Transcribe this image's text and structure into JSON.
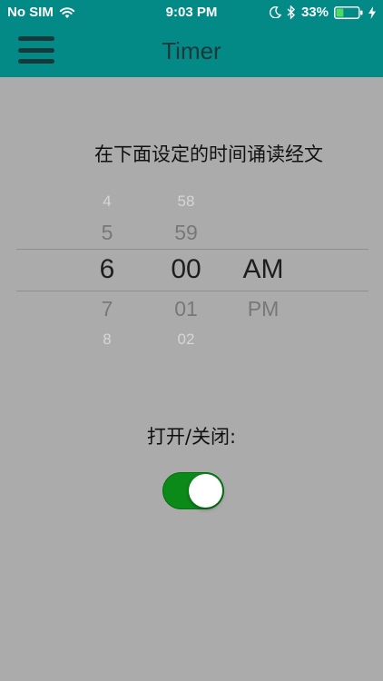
{
  "status_bar": {
    "carrier": "No SIM",
    "time": "9:03 PM",
    "battery_percent": "33%",
    "battery_level": 0.33,
    "icons": [
      "wifi-icon",
      "moon-icon",
      "bluetooth-icon",
      "battery-icon",
      "charging-icon"
    ]
  },
  "navbar": {
    "title": "Timer",
    "menu_icon": "hamburger-icon",
    "background_color": "#038a86"
  },
  "instruction": "在下面设定的时间诵读经文",
  "time_picker": {
    "hours": [
      "4",
      "5",
      "6",
      "7",
      "8"
    ],
    "minutes": [
      "58",
      "59",
      "00",
      "01",
      "02"
    ],
    "periods": [
      "AM",
      "PM"
    ],
    "selected": {
      "hour": "6",
      "minute": "00",
      "period": "AM"
    }
  },
  "toggle": {
    "label": "打开/关闭:",
    "on": true,
    "on_color": "#0b8a19"
  }
}
